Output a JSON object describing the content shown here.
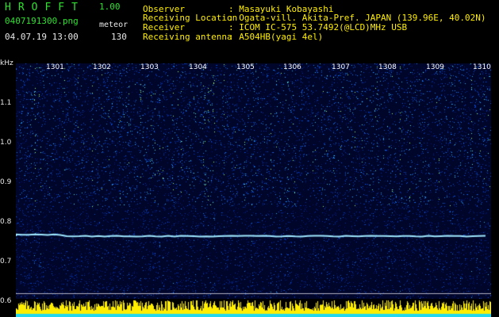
{
  "header": {
    "app_title": "HROFFT",
    "app_version": "1.00",
    "file_name": "0407191300.png",
    "mode_label": "meteor",
    "date_time": "04.07.19 13:00",
    "count": "130"
  },
  "station": [
    {
      "label": "Observer",
      "value": ": Masayuki Kobayashi"
    },
    {
      "label": "Receiving Location",
      "value": ": Ogata-vill. Akita-Pref. JAPAN (139.96E, 40.02N)"
    },
    {
      "label": "Receiver",
      "value": ": ICOM IC-575 53.7492(@LCD)MHz USB"
    },
    {
      "label": "Receiving antenna",
      "value": ": A504HB(yagi 4el)"
    }
  ],
  "spectrogram": {
    "y_unit": "kHz",
    "y_ticks": [
      "1.1",
      "1.0",
      "0.9",
      "0.8",
      "0.7",
      "0.6"
    ],
    "x_ticks": [
      "1301",
      "1302",
      "1303",
      "1304",
      "1305",
      "1306",
      "1307",
      "1308",
      "1309",
      "1310"
    ],
    "colors": {
      "background": "#00052a",
      "text_header": "#2fe02f",
      "text_info": "#e8e8e8",
      "tick_labels": "#ffffff"
    }
  }
}
